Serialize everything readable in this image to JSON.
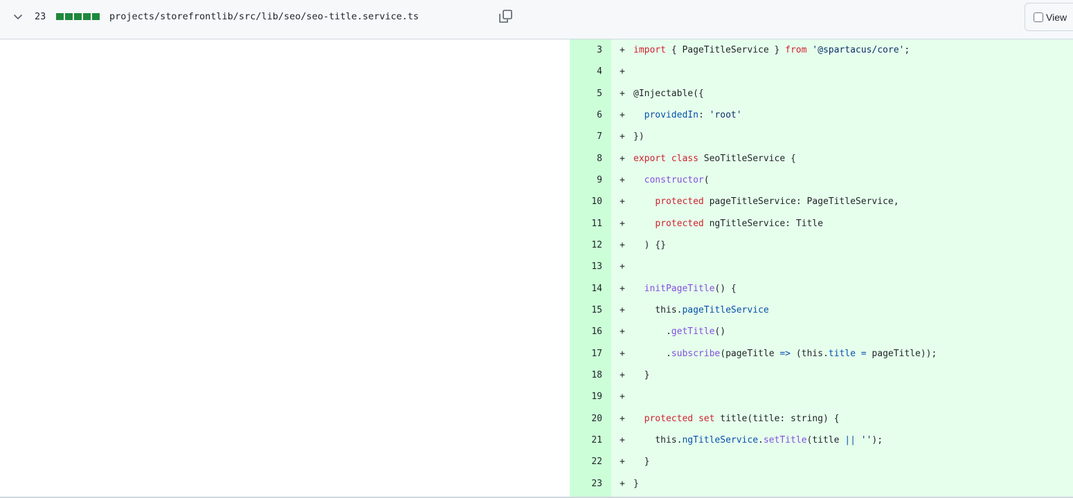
{
  "file_header": {
    "change_count": "23",
    "diffstat_blocks": 5,
    "diffstat_color": "#1f883d",
    "file_path": "projects/storefrontlib/src/lib/seo/seo-title.service.ts",
    "viewed_label": "View"
  },
  "icons": {
    "expand": "chevron-down-icon",
    "copy": "copy-icon"
  },
  "colors": {
    "addition_line_bg": "#e6ffec",
    "addition_gutter_bg": "#ccffd8",
    "keyword": "#cf222e",
    "string": "#0a3069",
    "function": "#8250df",
    "property": "#0550ae"
  },
  "diff_lines": [
    {
      "num": "3",
      "marker": "+",
      "code": "import { PageTitleService } from '@spartacus/core';"
    },
    {
      "num": "4",
      "marker": "+",
      "code": ""
    },
    {
      "num": "5",
      "marker": "+",
      "code": "@Injectable({"
    },
    {
      "num": "6",
      "marker": "+",
      "code": "  providedIn: 'root'"
    },
    {
      "num": "7",
      "marker": "+",
      "code": "})"
    },
    {
      "num": "8",
      "marker": "+",
      "code": "export class SeoTitleService {"
    },
    {
      "num": "9",
      "marker": "+",
      "code": "  constructor("
    },
    {
      "num": "10",
      "marker": "+",
      "code": "    protected pageTitleService: PageTitleService,"
    },
    {
      "num": "11",
      "marker": "+",
      "code": "    protected ngTitleService: Title"
    },
    {
      "num": "12",
      "marker": "+",
      "code": "  ) {}"
    },
    {
      "num": "13",
      "marker": "+",
      "code": ""
    },
    {
      "num": "14",
      "marker": "+",
      "code": "  initPageTitle() {"
    },
    {
      "num": "15",
      "marker": "+",
      "code": "    this.pageTitleService"
    },
    {
      "num": "16",
      "marker": "+",
      "code": "      .getTitle()"
    },
    {
      "num": "17",
      "marker": "+",
      "code": "      .subscribe(pageTitle => (this.title = pageTitle));"
    },
    {
      "num": "18",
      "marker": "+",
      "code": "  }"
    },
    {
      "num": "19",
      "marker": "+",
      "code": ""
    },
    {
      "num": "20",
      "marker": "+",
      "code": "  protected set title(title: string) {"
    },
    {
      "num": "21",
      "marker": "+",
      "code": "    this.ngTitleService.setTitle(title || '');"
    },
    {
      "num": "22",
      "marker": "+",
      "code": "  }"
    },
    {
      "num": "23",
      "marker": "+",
      "code": "}"
    }
  ]
}
